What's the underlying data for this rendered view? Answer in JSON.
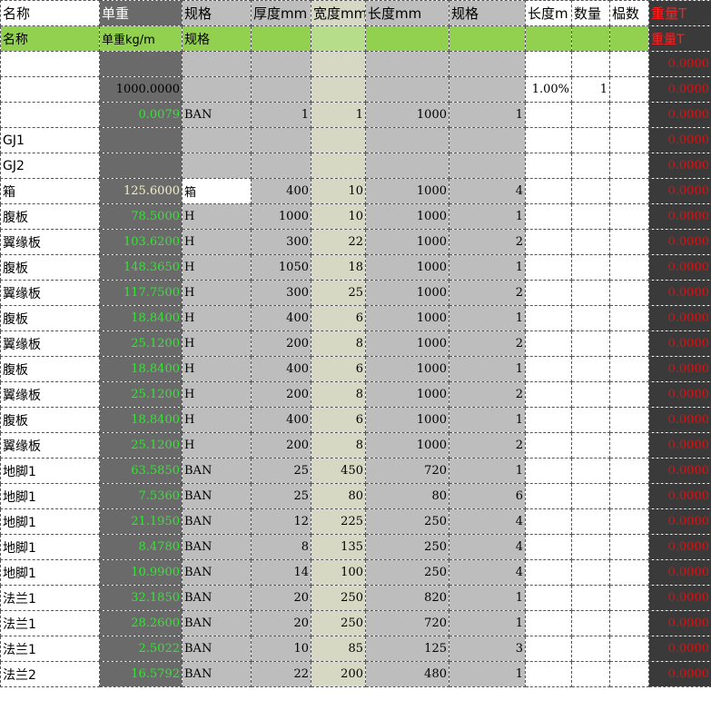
{
  "header1": {
    "name": "名称",
    "unit_weight": "单重",
    "spec": "规格",
    "thickness": "厚度mm",
    "width": "宽度mm",
    "length": "长度mm",
    "spec2": "规格",
    "len_m": "长度m",
    "qty": "数量",
    "extra": "榀数",
    "weight_t": "重量T"
  },
  "header2": {
    "name": "名称",
    "unit_weight": "单重kg/m",
    "spec": "规格",
    "weight_t": "重量T"
  },
  "rows": [
    {
      "name": "",
      "unit": "",
      "spec": "",
      "t": "",
      "w": "",
      "l": "",
      "s2": "",
      "m": "",
      "q": "",
      "wt": "0.0000"
    },
    {
      "name": "",
      "unit": "1000.0000",
      "spec": "",
      "t": "",
      "w": "",
      "l": "",
      "s2": "",
      "m": "1.00%",
      "q": "1",
      "wt": "0.0000"
    },
    {
      "name": "",
      "unit": "0.0079",
      "spec": "BAN",
      "t": "1",
      "w": "1",
      "l": "1000",
      "s2": "1",
      "m": "",
      "q": "",
      "wt": "0.0000"
    },
    {
      "name": "GJ1",
      "unit": "",
      "spec": "",
      "t": "",
      "w": "",
      "l": "",
      "s2": "",
      "m": "",
      "q": "",
      "wt": "0.0000"
    },
    {
      "name": "GJ2",
      "unit": "",
      "spec": "",
      "t": "",
      "w": "",
      "l": "",
      "s2": "",
      "m": "",
      "q": "",
      "wt": "0.0000"
    },
    {
      "name": "箱",
      "unit": "125.6000",
      "spec": "箱",
      "t": "400",
      "w": "10",
      "l": "1000",
      "s2": "4",
      "m": "",
      "q": "",
      "wt": "0.0000"
    },
    {
      "name": "腹板",
      "unit": "78.5000",
      "spec": "H",
      "t": "1000",
      "w": "10",
      "l": "1000",
      "s2": "1",
      "m": "",
      "q": "",
      "wt": "0.0000"
    },
    {
      "name": "翼缘板",
      "unit": "103.6200",
      "spec": "H",
      "t": "300",
      "w": "22",
      "l": "1000",
      "s2": "2",
      "m": "",
      "q": "",
      "wt": "0.0000"
    },
    {
      "name": "腹板",
      "unit": "148.3650",
      "spec": "H",
      "t": "1050",
      "w": "18",
      "l": "1000",
      "s2": "1",
      "m": "",
      "q": "",
      "wt": "0.0000"
    },
    {
      "name": "翼缘板",
      "unit": "117.7500",
      "spec": "H",
      "t": "300",
      "w": "25",
      "l": "1000",
      "s2": "2",
      "m": "",
      "q": "",
      "wt": "0.0000"
    },
    {
      "name": "腹板",
      "unit": "18.8400",
      "spec": "H",
      "t": "400",
      "w": "6",
      "l": "1000",
      "s2": "1",
      "m": "",
      "q": "",
      "wt": "0.0000"
    },
    {
      "name": "翼缘板",
      "unit": "25.1200",
      "spec": "H",
      "t": "200",
      "w": "8",
      "l": "1000",
      "s2": "2",
      "m": "",
      "q": "",
      "wt": "0.0000"
    },
    {
      "name": "腹板",
      "unit": "18.8400",
      "spec": "H",
      "t": "400",
      "w": "6",
      "l": "1000",
      "s2": "1",
      "m": "",
      "q": "",
      "wt": "0.0000"
    },
    {
      "name": "翼缘板",
      "unit": "25.1200",
      "spec": "H",
      "t": "200",
      "w": "8",
      "l": "1000",
      "s2": "2",
      "m": "",
      "q": "",
      "wt": "0.0000"
    },
    {
      "name": "腹板",
      "unit": "18.8400",
      "spec": "H",
      "t": "400",
      "w": "6",
      "l": "1000",
      "s2": "1",
      "m": "",
      "q": "",
      "wt": "0.0000"
    },
    {
      "name": "翼缘板",
      "unit": "25.1200",
      "spec": "H",
      "t": "200",
      "w": "8",
      "l": "1000",
      "s2": "2",
      "m": "",
      "q": "",
      "wt": "0.0000"
    },
    {
      "name": "地脚1",
      "unit": "63.5850",
      "spec": "BAN",
      "t": "25",
      "w": "450",
      "l": "720",
      "s2": "1",
      "m": "",
      "q": "",
      "wt": "0.0000"
    },
    {
      "name": "地脚1",
      "unit": "7.5360",
      "spec": "BAN",
      "t": "25",
      "w": "80",
      "l": "80",
      "s2": "6",
      "m": "",
      "q": "",
      "wt": "0.0000"
    },
    {
      "name": "地脚1",
      "unit": "21.1950",
      "spec": "BAN",
      "t": "12",
      "w": "225",
      "l": "250",
      "s2": "4",
      "m": "",
      "q": "",
      "wt": "0.0000"
    },
    {
      "name": "地脚1",
      "unit": "8.4780",
      "spec": "BAN",
      "t": "8",
      "w": "135",
      "l": "250",
      "s2": "4",
      "m": "",
      "q": "",
      "wt": "0.0000"
    },
    {
      "name": "地脚1",
      "unit": "10.9900",
      "spec": "BAN",
      "t": "14",
      "w": "100",
      "l": "250",
      "s2": "4",
      "m": "",
      "q": "",
      "wt": "0.0000"
    },
    {
      "name": "法兰1",
      "unit": "32.1850",
      "spec": "BAN",
      "t": "20",
      "w": "250",
      "l": "820",
      "s2": "1",
      "m": "",
      "q": "",
      "wt": "0.0000"
    },
    {
      "name": "法兰1",
      "unit": "28.2600",
      "spec": "BAN",
      "t": "20",
      "w": "250",
      "l": "720",
      "s2": "1",
      "m": "",
      "q": "",
      "wt": "0.0000"
    },
    {
      "name": "法兰1",
      "unit": "2.5022",
      "spec": "BAN",
      "t": "10",
      "w": "85",
      "l": "125",
      "s2": "3",
      "m": "",
      "q": "",
      "wt": "0.0000"
    },
    {
      "name": "法兰2",
      "unit": "16.5792",
      "spec": "BAN",
      "t": "22",
      "w": "200",
      "l": "480",
      "s2": "1",
      "m": "",
      "q": "",
      "wt": "0.0000"
    }
  ]
}
